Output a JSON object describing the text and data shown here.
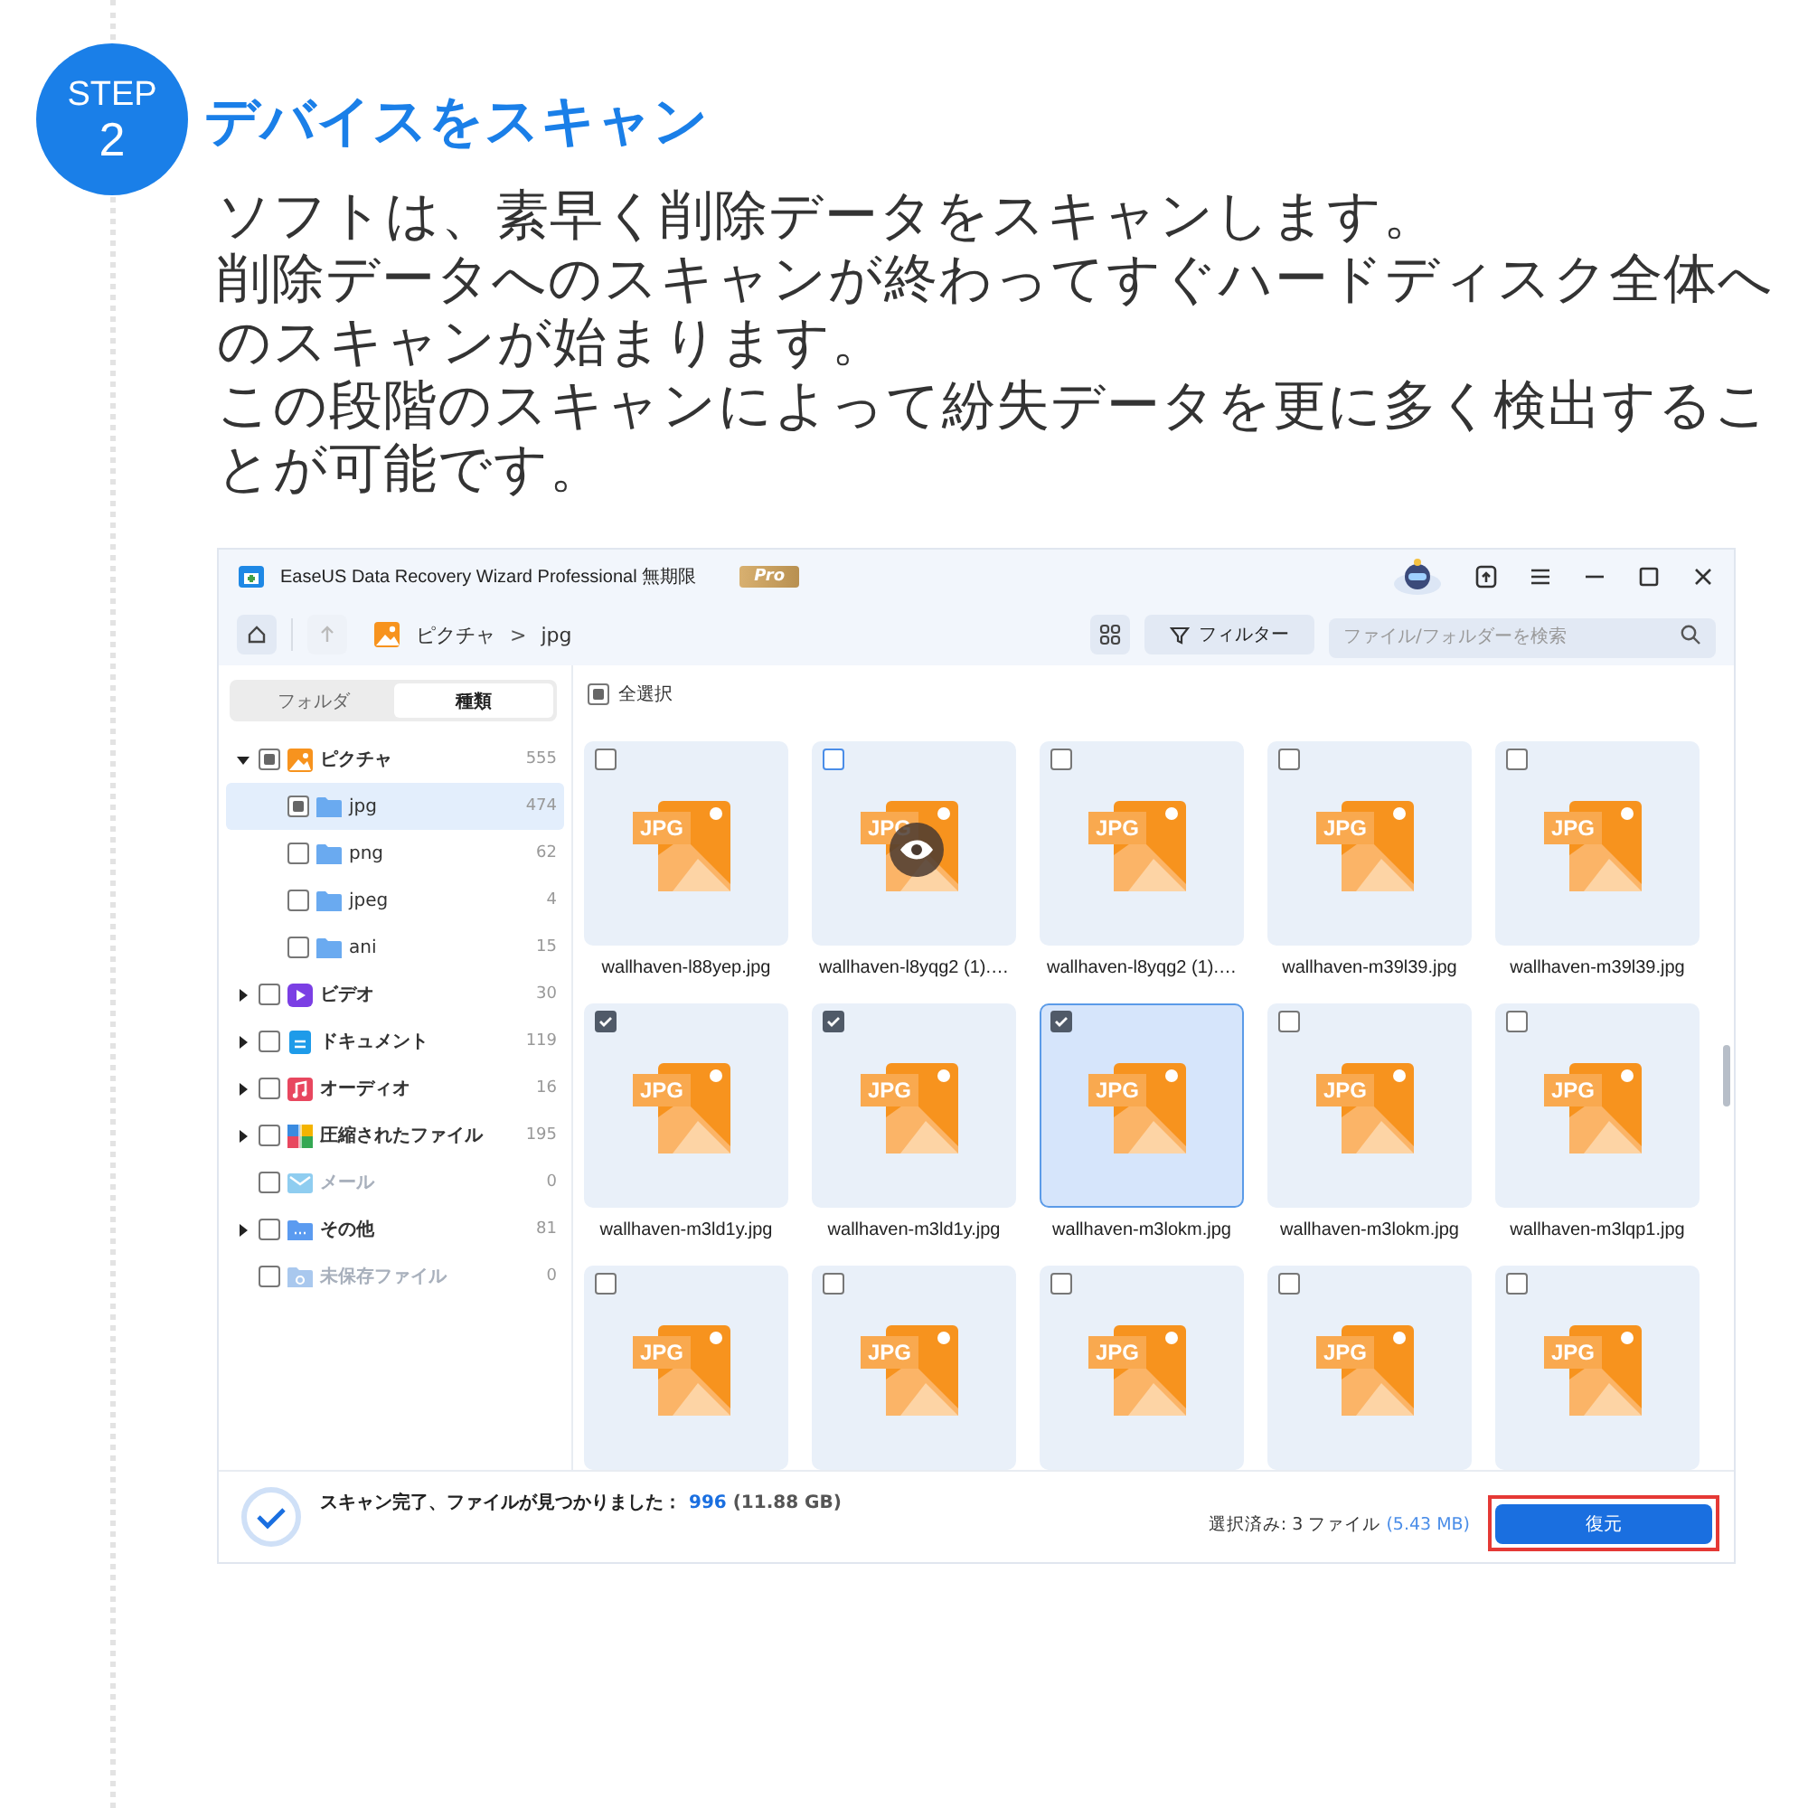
{
  "step": {
    "label": "STEP",
    "number": "2"
  },
  "heading": "デバイスをスキャン",
  "paragraphs": [
    "ソフトは、素早く削除データをスキャンします。",
    "削除データへのスキャンが終わってすぐハードディスク全体へのスキャンが始まります。",
    "この段階のスキャンによって紛失データを更に多く検出することが可能です。"
  ],
  "app": {
    "title": "EaseUS Data Recovery Wizard Professional 無期限",
    "badge": "Pro",
    "breadcrumb": [
      "ピクチャ",
      "jpg"
    ],
    "breadcrumb_separator": ">",
    "filter_button": "フィルター",
    "search": {
      "placeholder": "ファイル/フォルダーを検索"
    },
    "side_tabs": [
      {
        "label": "フォルダ",
        "selected": false
      },
      {
        "label": "種類",
        "selected": true
      }
    ],
    "tree": [
      {
        "label": "ピクチャ",
        "count": "555",
        "kind": "picture",
        "color": "#f7931e",
        "checked": false,
        "mixed": true,
        "expanded": true,
        "disabled": false,
        "selected": false,
        "children": [
          {
            "label": "jpg",
            "count": "474",
            "kind": "folder",
            "color": "#6aaaf0",
            "checked": false,
            "mixed": true,
            "disabled": false,
            "selected": true
          },
          {
            "label": "png",
            "count": "62",
            "kind": "folder",
            "color": "#6aaaf0",
            "checked": false,
            "mixed": false,
            "disabled": false,
            "selected": false
          },
          {
            "label": "jpeg",
            "count": "4",
            "kind": "folder",
            "color": "#6aaaf0",
            "checked": false,
            "mixed": false,
            "disabled": false,
            "selected": false
          },
          {
            "label": "ani",
            "count": "15",
            "kind": "folder",
            "color": "#6aaaf0",
            "checked": false,
            "mixed": false,
            "disabled": false,
            "selected": false
          }
        ]
      },
      {
        "label": "ビデオ",
        "count": "30",
        "kind": "video",
        "color": "#7b3fe4",
        "checked": false,
        "mixed": false,
        "expanded": false,
        "disabled": false,
        "selected": false
      },
      {
        "label": "ドキュメント",
        "count": "119",
        "kind": "document",
        "color": "#1e9be9",
        "checked": false,
        "mixed": false,
        "expanded": false,
        "disabled": false,
        "selected": false
      },
      {
        "label": "オーディオ",
        "count": "16",
        "kind": "audio",
        "color": "#e8475f",
        "checked": false,
        "mixed": false,
        "expanded": false,
        "disabled": false,
        "selected": false
      },
      {
        "label": "圧縮されたファイル",
        "count": "195",
        "kind": "archive",
        "color": "#3a8be0",
        "checked": false,
        "mixed": false,
        "expanded": false,
        "disabled": false,
        "selected": false
      },
      {
        "label": "メール",
        "count": "0",
        "kind": "mail",
        "color": "#8fcdf0",
        "checked": false,
        "mixed": false,
        "disabled": true,
        "selected": false
      },
      {
        "label": "その他",
        "count": "81",
        "kind": "other",
        "color": "#5b9bf0",
        "checked": false,
        "mixed": false,
        "expanded": false,
        "disabled": false,
        "selected": false
      },
      {
        "label": "未保存ファイル",
        "count": "0",
        "kind": "unsaved",
        "color": "#a9c8ee",
        "checked": false,
        "mixed": false,
        "disabled": true,
        "selected": false
      }
    ],
    "select_all": {
      "label": "全選択",
      "checked": false,
      "mixed": true
    },
    "files": [
      {
        "name": "wallhaven-l88yep.jpg",
        "thumb": "JPG",
        "checked": false,
        "selected": false,
        "hover": false
      },
      {
        "name": "wallhaven-l8yqg2 (1).…",
        "thumb": "JPG",
        "checked": false,
        "selected": false,
        "hover": true
      },
      {
        "name": "wallhaven-l8yqg2 (1).…",
        "thumb": "JPG",
        "checked": false,
        "selected": false,
        "hover": false
      },
      {
        "name": "wallhaven-m39l39.jpg",
        "thumb": "JPG",
        "checked": false,
        "selected": false,
        "hover": false
      },
      {
        "name": "wallhaven-m39l39.jpg",
        "thumb": "JPG",
        "checked": false,
        "selected": false,
        "hover": false
      },
      {
        "name": "wallhaven-m3ld1y.jpg",
        "thumb": "JPG",
        "checked": true,
        "selected": false,
        "hover": false
      },
      {
        "name": "wallhaven-m3ld1y.jpg",
        "thumb": "JPG",
        "checked": true,
        "selected": false,
        "hover": false
      },
      {
        "name": "wallhaven-m3lokm.jpg",
        "thumb": "JPG",
        "checked": true,
        "selected": true,
        "hover": false
      },
      {
        "name": "wallhaven-m3lokm.jpg",
        "thumb": "JPG",
        "checked": false,
        "selected": false,
        "hover": false
      },
      {
        "name": "wallhaven-m3lqp1.jpg",
        "thumb": "JPG",
        "checked": false,
        "selected": false,
        "hover": false
      },
      {
        "thumb": "JPG",
        "checked": false,
        "selected": false,
        "hover": false
      },
      {
        "thumb": "JPG",
        "checked": false,
        "selected": false,
        "hover": false
      },
      {
        "thumb": "JPG",
        "checked": false,
        "selected": false,
        "hover": false
      },
      {
        "thumb": "JPG",
        "checked": false,
        "selected": false,
        "hover": false
      },
      {
        "thumb": "JPG",
        "checked": false,
        "selected": false,
        "hover": false
      }
    ],
    "status": {
      "message": "スキャン完了、ファイルが見つかりました：",
      "count": "996",
      "size": "(11.88 GB)"
    },
    "selection": {
      "label": "選択済み: 3 ファイル",
      "size": "(5.43 MB)"
    },
    "recover_button": {
      "label": "復元",
      "highlighted": true
    }
  }
}
